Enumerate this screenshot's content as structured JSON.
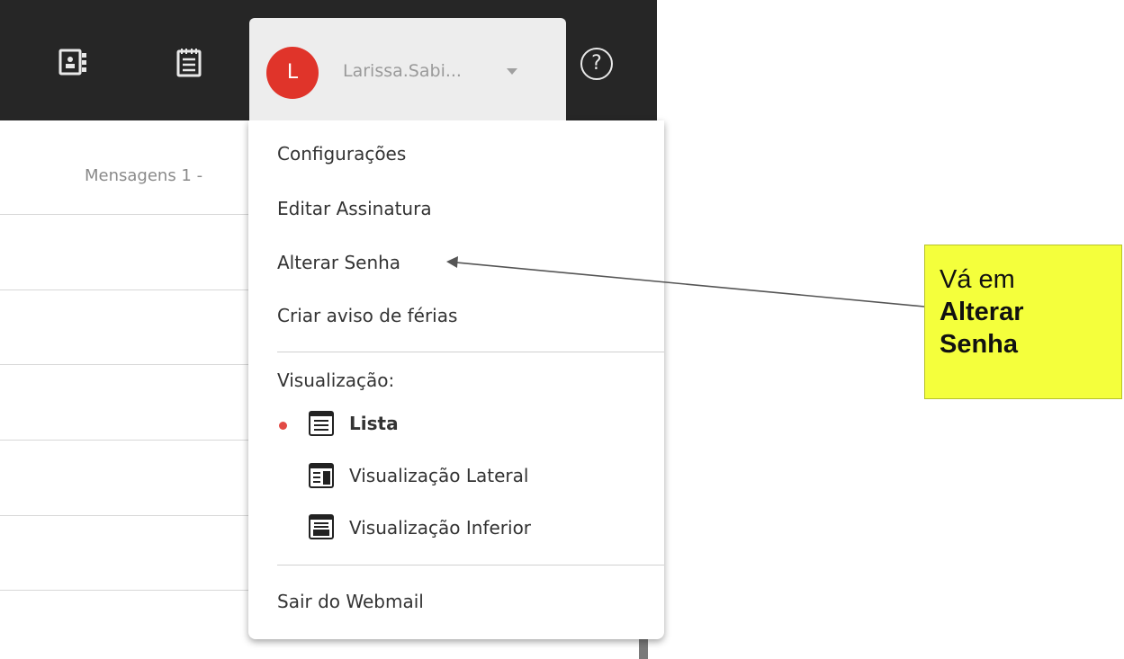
{
  "user": {
    "initial": "L",
    "name": "Larissa.Sabi..."
  },
  "header": {
    "help_glyph": "?"
  },
  "list": {
    "message_count": "Mensagens 1 -"
  },
  "menu": {
    "configuracoes": "Configurações",
    "editar_assinatura": "Editar Assinatura",
    "alterar_senha": "Alterar Senha",
    "criar_aviso": "Criar aviso de férias",
    "visualizacao_heading": "Visualização:",
    "view_options": [
      {
        "label": "Lista",
        "selected": true,
        "icon": "list-view-icon"
      },
      {
        "label": "Visualização Lateral",
        "selected": false,
        "icon": "side-view-icon"
      },
      {
        "label": "Visualização Inferior",
        "selected": false,
        "icon": "bottom-view-icon"
      }
    ],
    "sair": "Sair do Webmail"
  },
  "annotation": {
    "line1": "Vá em",
    "line2": "Alterar",
    "line3": "Senha"
  },
  "colors": {
    "topbar": "#262626",
    "avatar": "#e0342a",
    "callout": "#f4ff3c",
    "selected_bullet": "#e24a45"
  }
}
